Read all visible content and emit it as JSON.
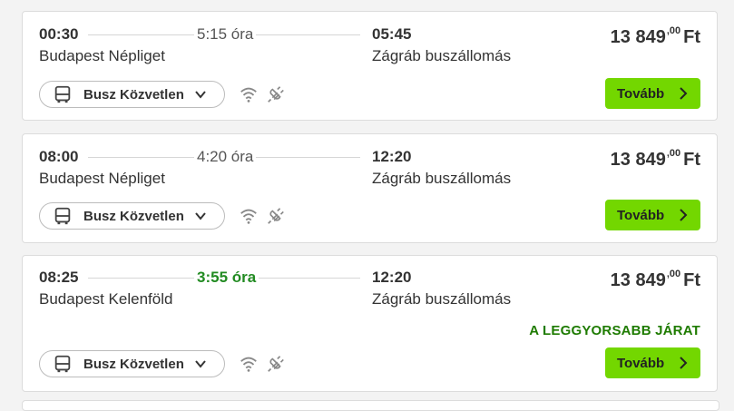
{
  "trips": [
    {
      "departure_time": "00:30",
      "duration": "5:15 óra",
      "arrival_time": "05:45",
      "from": "Budapest Népliget",
      "to": "Zágráb buszállomás",
      "price_main": "13 849",
      "price_decimals": ",00",
      "currency": "Ft",
      "transport_label": "Busz Közvetlen",
      "button_label": "Tovább",
      "fastest": false,
      "badge": ""
    },
    {
      "departure_time": "08:00",
      "duration": "4:20 óra",
      "arrival_time": "12:20",
      "from": "Budapest Népliget",
      "to": "Zágráb buszállomás",
      "price_main": "13 849",
      "price_decimals": ",00",
      "currency": "Ft",
      "transport_label": "Busz Közvetlen",
      "button_label": "Tovább",
      "fastest": false,
      "badge": ""
    },
    {
      "departure_time": "08:25",
      "duration": "3:55 óra",
      "arrival_time": "12:20",
      "from": "Budapest Kelenföld",
      "to": "Zágráb buszállomás",
      "price_main": "13 849",
      "price_decimals": ",00",
      "currency": "Ft",
      "transport_label": "Busz Közvetlen",
      "button_label": "Tovább",
      "fastest": true,
      "badge": "A LEGGYORSABB JÁRAT"
    }
  ],
  "amenities": [
    "wifi-icon",
    "power-plug-icon"
  ],
  "colors": {
    "button_green": "#73d700",
    "fastest_green": "#228b22",
    "text": "#333333"
  }
}
